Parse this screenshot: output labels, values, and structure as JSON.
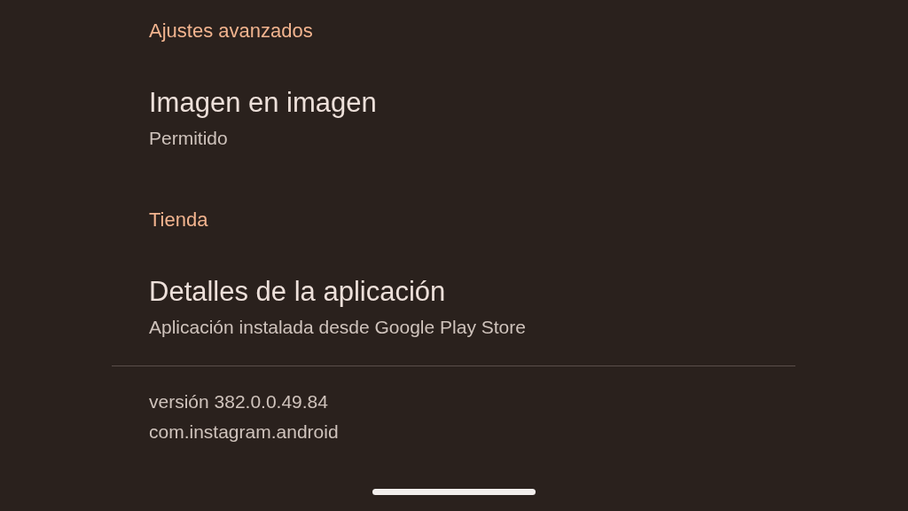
{
  "sections": [
    {
      "header": "Ajustes avanzados",
      "items": [
        {
          "title": "Imagen en imagen",
          "subtitle": "Permitido"
        }
      ]
    },
    {
      "header": "Tienda",
      "items": [
        {
          "title": "Detalles de la aplicación",
          "subtitle": "Aplicación instalada desde Google Play Store"
        }
      ]
    }
  ],
  "footer": {
    "lines": [
      "versión 382.0.0.49.84",
      "com.instagram.android"
    ]
  }
}
